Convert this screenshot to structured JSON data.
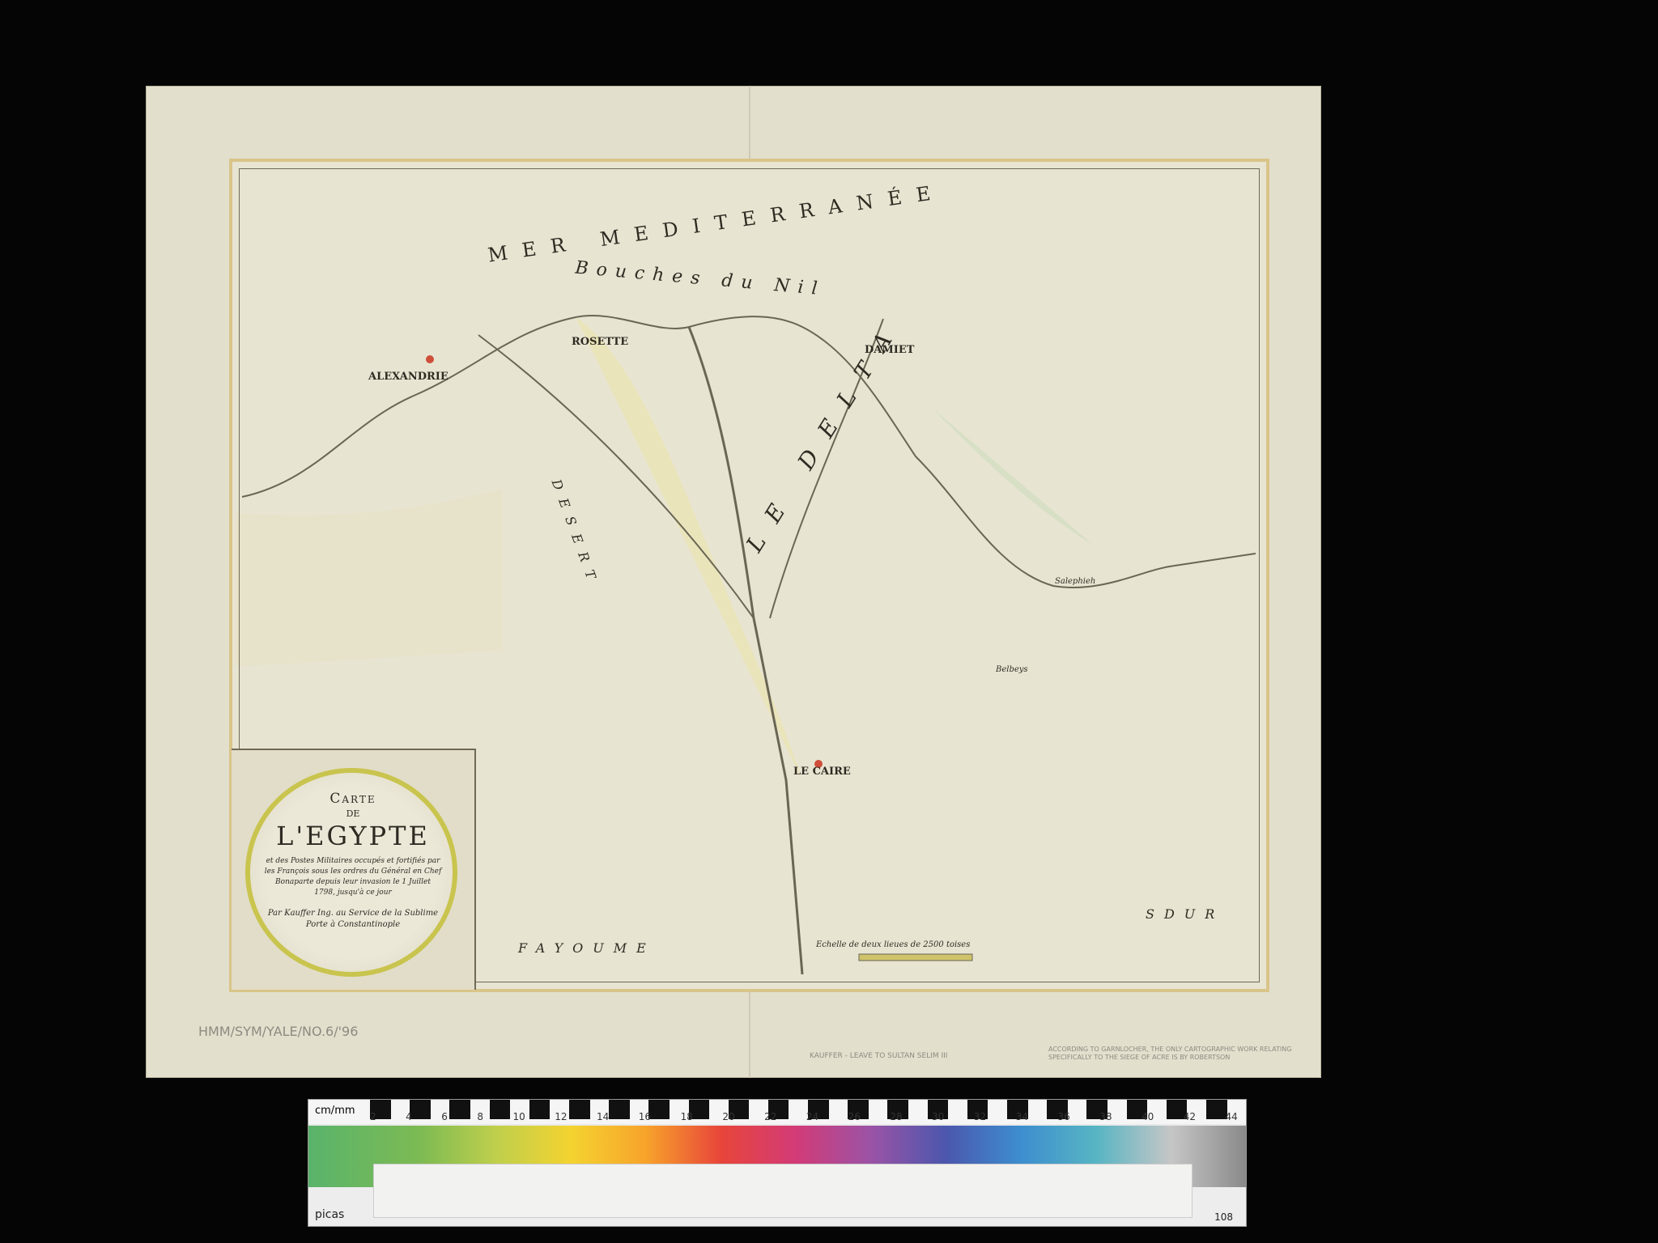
{
  "cartouche": {
    "carte": "Carte",
    "de": "DE",
    "title": "L'EGYPTE",
    "subtitle": "et des Postes Militaires occupés et fortifiés par les François sous les ordres du Général en Chef Bonaparte depuis leur invasion le 1 Juillet 1798, jusqu'à ce jour",
    "author": "Par Kauffer Ing. au Service de la Sublime Porte à Constantinople"
  },
  "map_labels": {
    "sea": "MER MEDITERRANÉE",
    "bouches": "Bouches du Nil",
    "alexandrie": "ALEXANDRIE",
    "rosette": "ROSETTE",
    "damiet": "DAMIET",
    "le_caire": "LE CAIRE",
    "delta": "LE DELTA",
    "desert": "DESERT",
    "fayoum": "FAYOUME",
    "sdur": "SDUR",
    "salehieh": "Salephieh",
    "belbeys": "Belbeys",
    "scale": "Echelle de deux lieues de 2500 toises"
  },
  "pencil_notes": {
    "left": "HMM/SYM/YALE/NO.6/'96",
    "center": "KAUFFER - LEAVE TO SULTAN SELIM III",
    "right": "ACCORDING TO GARNLOCHER, THE ONLY CARTOGRAPHIC WORK RELATING SPECIFICALLY TO THE SIEGE OF ACRE IS BY ROBERTSON"
  },
  "ruler": {
    "unit_top": "cm/mm",
    "unit_bottom": "picas",
    "end_number": "108",
    "numbers": [
      "2",
      "4",
      "6",
      "8",
      "10",
      "12",
      "14",
      "16",
      "18",
      "20",
      "22",
      "24",
      "26",
      "28",
      "30",
      "32",
      "34",
      "36",
      "38",
      "40",
      "42",
      "44"
    ]
  }
}
